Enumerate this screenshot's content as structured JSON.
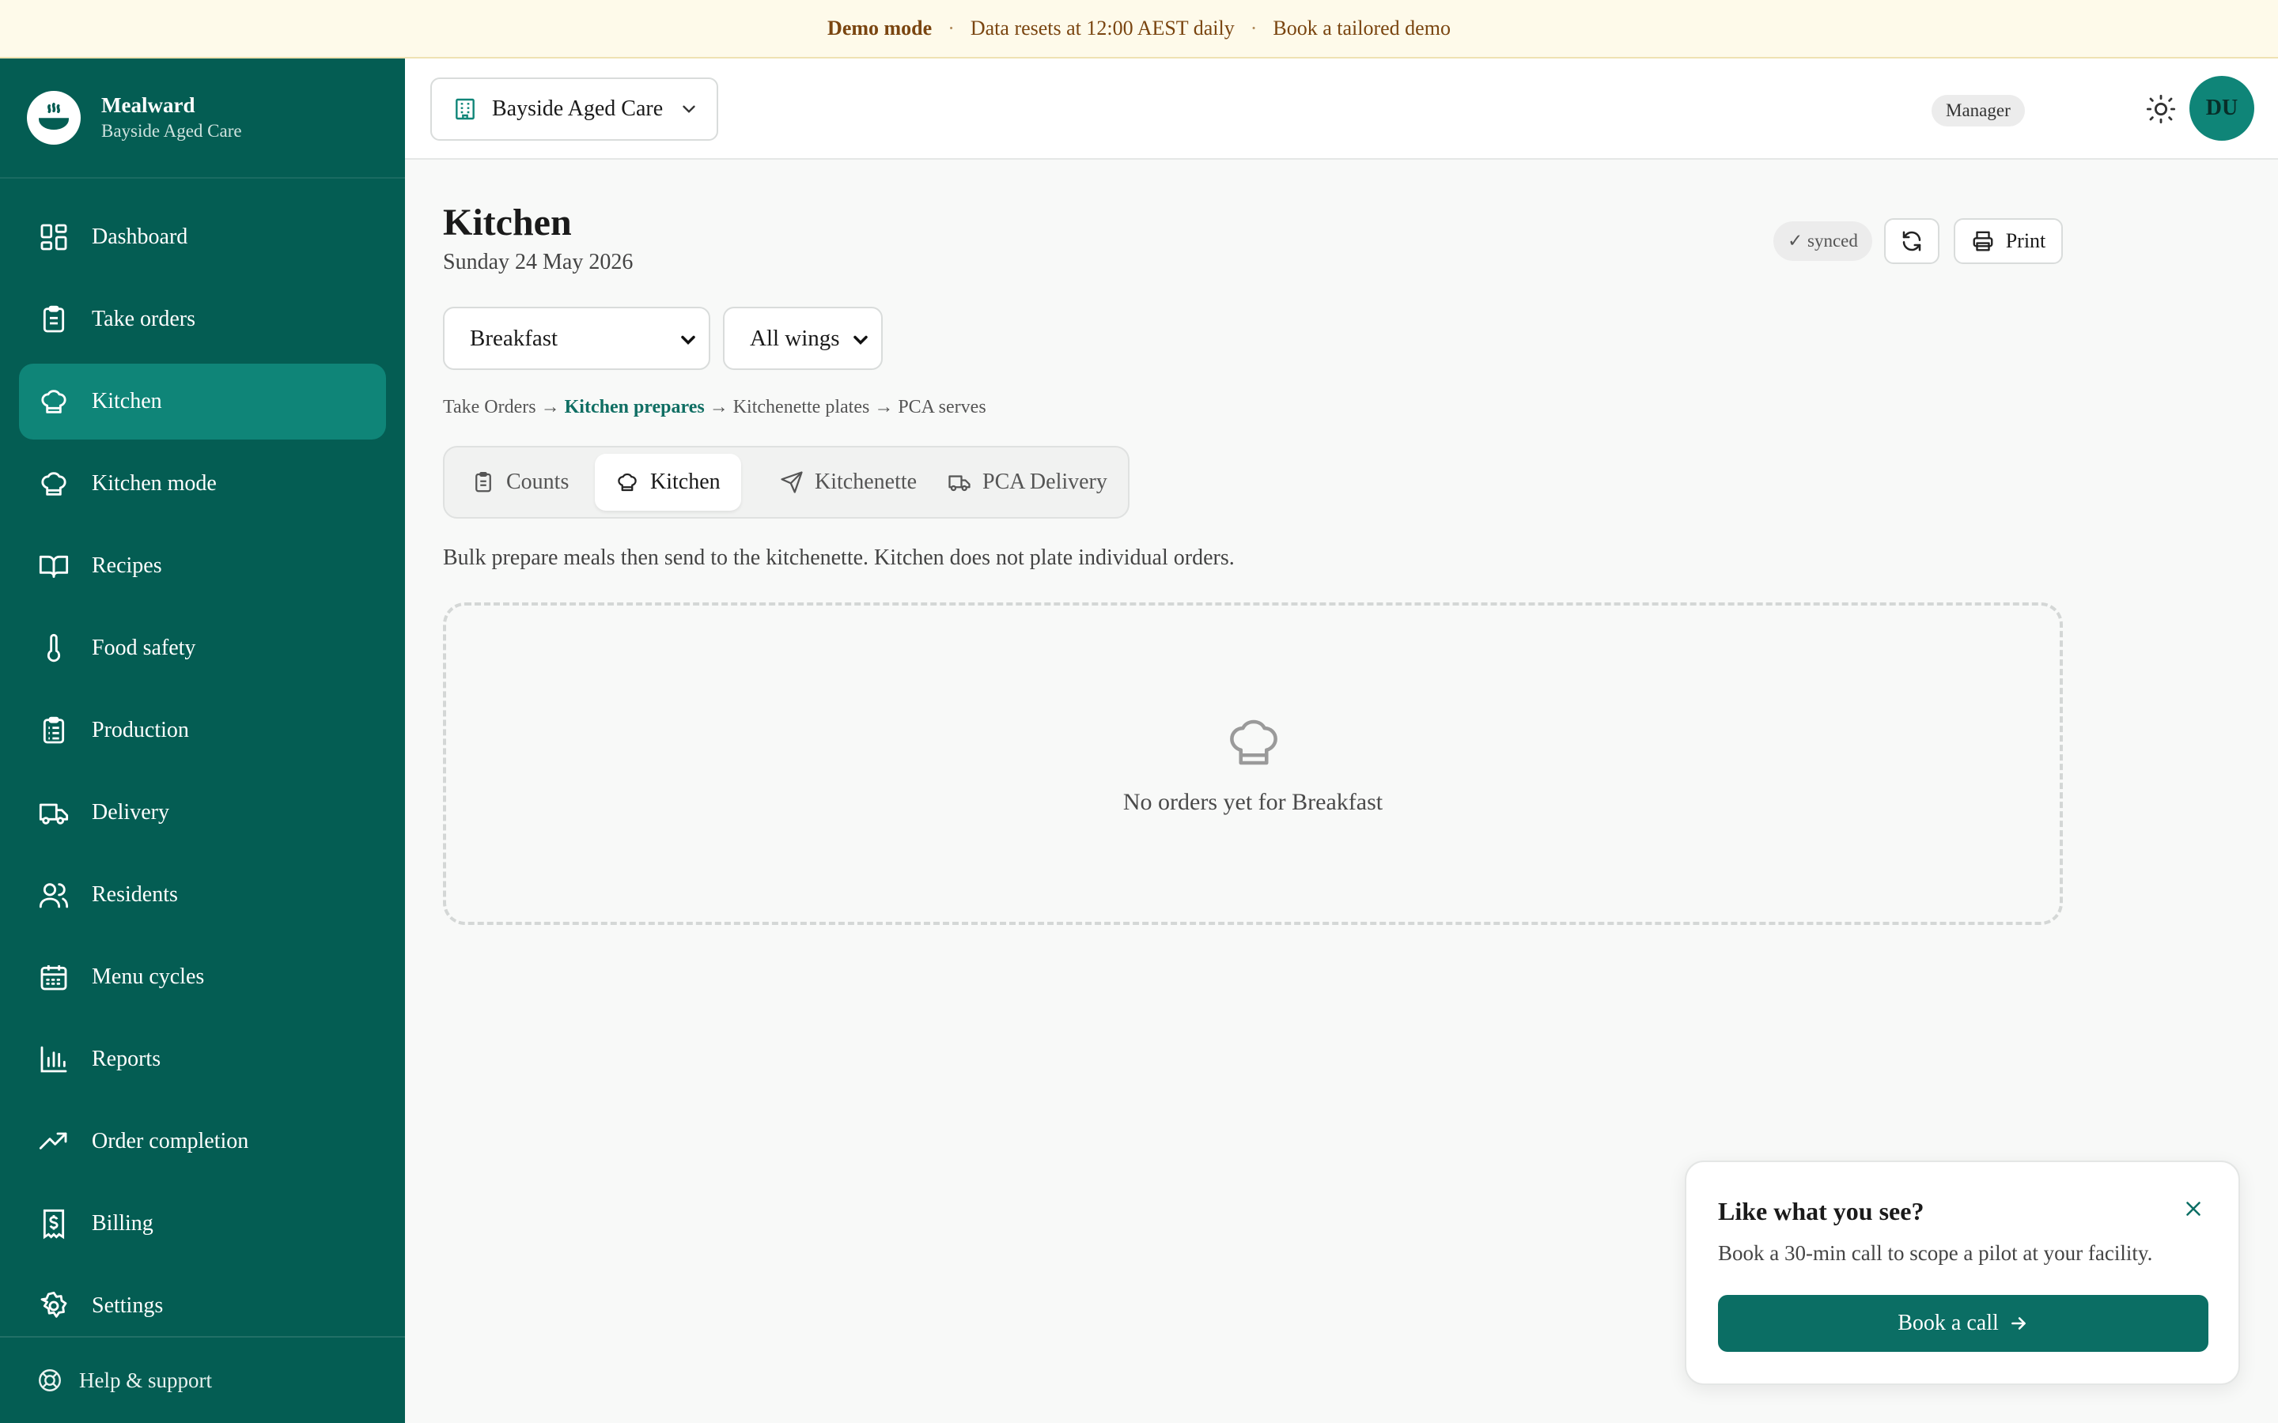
{
  "banner": {
    "mode": "Demo mode",
    "sep": "·",
    "reset_note": "Data resets at 12:00 AEST daily",
    "demo_link": "Book a tailored demo"
  },
  "brand": {
    "name": "Mealward",
    "facility": "Bayside Aged Care"
  },
  "sidebar": {
    "items": [
      {
        "label": "Dashboard",
        "icon": "dashboard-icon"
      },
      {
        "label": "Take orders",
        "icon": "clipboard-icon"
      },
      {
        "label": "Kitchen",
        "icon": "chef-hat-icon",
        "active": true
      },
      {
        "label": "Kitchen mode",
        "icon": "chef-hat-icon"
      },
      {
        "label": "Recipes",
        "icon": "book-icon"
      },
      {
        "label": "Food safety",
        "icon": "thermometer-icon"
      },
      {
        "label": "Production",
        "icon": "clipboard-list-icon"
      },
      {
        "label": "Delivery",
        "icon": "truck-icon"
      },
      {
        "label": "Residents",
        "icon": "users-icon"
      },
      {
        "label": "Menu cycles",
        "icon": "calendar-icon"
      },
      {
        "label": "Reports",
        "icon": "bar-chart-icon"
      },
      {
        "label": "Order completion",
        "icon": "trending-up-icon"
      },
      {
        "label": "Billing",
        "icon": "receipt-icon"
      },
      {
        "label": "Settings",
        "icon": "gear-icon"
      }
    ],
    "help": "Help & support"
  },
  "topbar": {
    "facility_select": "Bayside Aged Care",
    "role": "Manager",
    "avatar_initials": "DU"
  },
  "page": {
    "title": "Kitchen",
    "date": "Sunday 24 May 2026",
    "sync_status": "✓ synced",
    "print_label": "Print",
    "meal_select": "Breakfast",
    "wing_select": "All wings",
    "flow": {
      "step1": "Take Orders",
      "arrow": "→",
      "step2": "Kitchen prepares",
      "step3": "Kitchenette plates",
      "step4": "PCA serves"
    },
    "tabs": [
      {
        "label": "Counts",
        "icon": "clipboard-icon"
      },
      {
        "label": "Kitchen",
        "icon": "chef-hat-icon",
        "active": true
      },
      {
        "label": "Kitchenette",
        "icon": "send-icon"
      },
      {
        "label": "PCA Delivery",
        "icon": "truck-icon"
      }
    ],
    "description": "Bulk prepare meals then send to the kitchenette. Kitchen does not plate individual orders.",
    "empty_state": "No orders yet for Breakfast"
  },
  "popup": {
    "title": "Like what you see?",
    "description": "Book a 30-min call to scope a pilot at your facility.",
    "button": "Book a call"
  },
  "colors": {
    "sidebar_bg": "#045d53",
    "accent": "#0f8578",
    "cta": "#0b6e64",
    "banner_bg": "#fefaea",
    "banner_text": "#7a4510"
  }
}
